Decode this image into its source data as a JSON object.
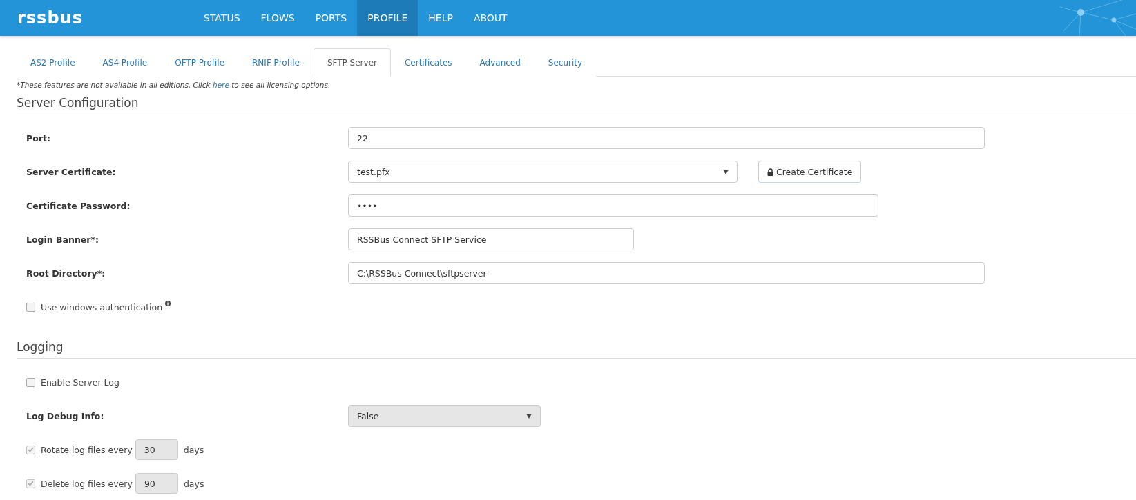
{
  "header": {
    "logo": "rssbus",
    "nav": [
      {
        "label": "STATUS",
        "selected": false
      },
      {
        "label": "FLOWS",
        "selected": false
      },
      {
        "label": "PORTS",
        "selected": false
      },
      {
        "label": "PROFILE",
        "selected": true
      },
      {
        "label": "HELP",
        "selected": false
      },
      {
        "label": "ABOUT",
        "selected": false
      }
    ]
  },
  "tabs": [
    {
      "label": "AS2 Profile",
      "selected": false
    },
    {
      "label": "AS4 Profile",
      "selected": false
    },
    {
      "label": "OFTP Profile",
      "selected": false
    },
    {
      "label": "RNIF Profile",
      "selected": false
    },
    {
      "label": "SFTP Server",
      "selected": true
    },
    {
      "label": "Certificates",
      "selected": false
    },
    {
      "label": "Advanced",
      "selected": false
    },
    {
      "label": "Security",
      "selected": false
    }
  ],
  "notice": {
    "before": "*These features are not available in all editions. Click",
    "link": "here",
    "after": "to see all licensing options."
  },
  "sections": [
    {
      "title": "Server Configuration",
      "rows": [
        {
          "kind": "input",
          "label": "Port:",
          "value": "22"
        },
        {
          "kind": "select",
          "label": "Server Certificate:",
          "value": "test.pfx",
          "disabled": false,
          "button": "Create Certificate"
        },
        {
          "kind": "password",
          "label": "Certificate Password:",
          "value": "••••"
        },
        {
          "kind": "input",
          "label": "Login Banner*:",
          "value": "RSSBus Connect SFTP Service"
        },
        {
          "kind": "input",
          "label": "Root Directory*:",
          "value": "C:\\RSSBus Connect\\sftpserver"
        },
        {
          "kind": "checkbox",
          "label": "Use windows authentication",
          "checked": false,
          "disabled": false,
          "info": true
        }
      ]
    },
    {
      "title": "Logging",
      "rows": [
        {
          "kind": "checkbox",
          "label": "Enable Server Log",
          "checked": false,
          "disabled": false
        },
        {
          "kind": "select",
          "label": "Log Debug Info:",
          "value": "False",
          "disabled": true
        },
        {
          "kind": "interval",
          "label": "Rotate log files every",
          "value": "30",
          "unit": "days",
          "checked": true,
          "disabled": true
        },
        {
          "kind": "interval",
          "label": "Delete log files every",
          "value": "90",
          "unit": "days",
          "checked": true,
          "disabled": true
        }
      ]
    }
  ]
}
